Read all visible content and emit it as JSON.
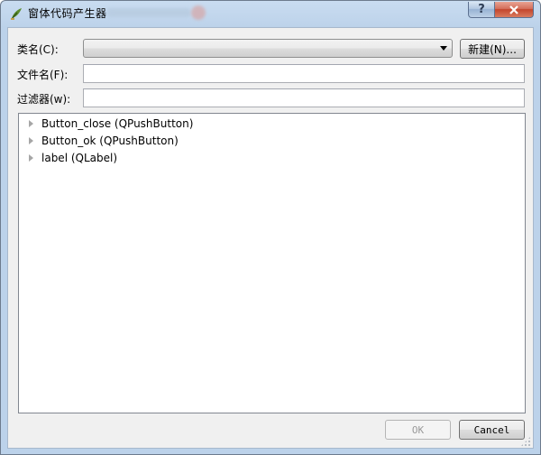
{
  "window": {
    "title": "窗体代码产生器"
  },
  "form": {
    "class_label": "类名(C):",
    "class_value": "",
    "new_button": "新建(N)...",
    "filename_label": "文件名(F):",
    "filename_value": "",
    "filter_label": "过滤器(w):",
    "filter_value": ""
  },
  "tree": {
    "items": [
      {
        "label": "Button_close (QPushButton)"
      },
      {
        "label": "Button_ok (QPushButton)"
      },
      {
        "label": "label (QLabel)"
      }
    ]
  },
  "buttons": {
    "ok": "OK",
    "cancel": "Cancel"
  },
  "icons": {
    "app": "leaf-pen-icon",
    "help": "question-mark-icon",
    "close": "close-x-icon"
  }
}
